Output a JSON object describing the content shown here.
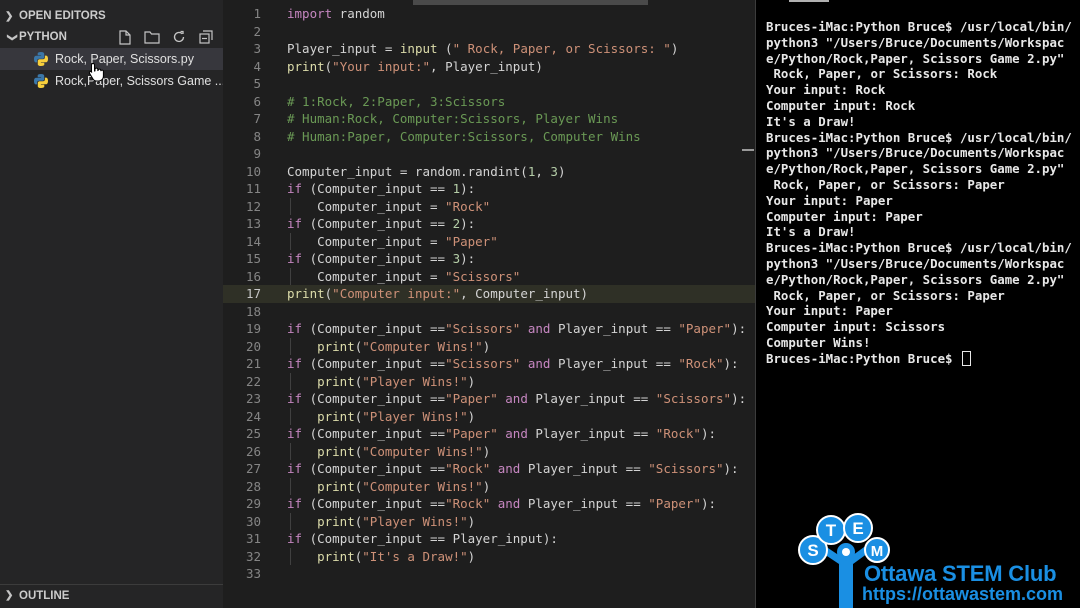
{
  "sidebar": {
    "open_editors_label": "OPEN EDITORS",
    "folder_label": "PYTHON",
    "outline_label": "OUTLINE",
    "actions": [
      "new-file-icon",
      "new-folder-icon",
      "refresh-icon",
      "collapse-all-icon"
    ],
    "files": [
      {
        "name": "Rock, Paper, Scissors.py",
        "selected": true
      },
      {
        "name": "Rock,Paper, Scissors Game ...",
        "selected": false
      }
    ]
  },
  "editor": {
    "current_line": 17,
    "lines": [
      {
        "n": "1",
        "tokens": [
          [
            "kw",
            "import"
          ],
          [
            "op",
            " random"
          ]
        ]
      },
      {
        "n": "2",
        "tokens": []
      },
      {
        "n": "3",
        "tokens": [
          [
            "op",
            "Player_input = "
          ],
          [
            "fn",
            "input"
          ],
          [
            "op",
            " ("
          ],
          [
            "str",
            "\" Rock, Paper, or Scissors: \""
          ],
          [
            "op",
            ")"
          ]
        ]
      },
      {
        "n": "4",
        "tokens": [
          [
            "fn",
            "print"
          ],
          [
            "op",
            "("
          ],
          [
            "str",
            "\"Your input:\""
          ],
          [
            "op",
            ", Player_input)"
          ]
        ]
      },
      {
        "n": "5",
        "tokens": []
      },
      {
        "n": "6",
        "tokens": [
          [
            "cm",
            "# 1:Rock, 2:Paper, 3:Scissors"
          ]
        ]
      },
      {
        "n": "7",
        "tokens": [
          [
            "cm",
            "# Human:Rock, Computer:Scissors, Player Wins"
          ]
        ]
      },
      {
        "n": "8",
        "tokens": [
          [
            "cm",
            "# Human:Paper, Computer:Scissors, Computer Wins"
          ]
        ]
      },
      {
        "n": "9",
        "tokens": []
      },
      {
        "n": "10",
        "tokens": [
          [
            "op",
            "Computer_input = random.randint("
          ],
          [
            "num",
            "1"
          ],
          [
            "op",
            ", "
          ],
          [
            "num",
            "3"
          ],
          [
            "op",
            ")"
          ]
        ]
      },
      {
        "n": "11",
        "tokens": [
          [
            "kw",
            "if"
          ],
          [
            "op",
            " (Computer_input == "
          ],
          [
            "num",
            "1"
          ],
          [
            "op",
            "):"
          ]
        ]
      },
      {
        "n": "12",
        "indent": true,
        "tokens": [
          [
            "op",
            "    Computer_input = "
          ],
          [
            "str",
            "\"Rock\""
          ]
        ]
      },
      {
        "n": "13",
        "tokens": [
          [
            "kw",
            "if"
          ],
          [
            "op",
            " (Computer_input == "
          ],
          [
            "num",
            "2"
          ],
          [
            "op",
            "):"
          ]
        ]
      },
      {
        "n": "14",
        "indent": true,
        "tokens": [
          [
            "op",
            "    Computer_input = "
          ],
          [
            "str",
            "\"Paper\""
          ]
        ]
      },
      {
        "n": "15",
        "tokens": [
          [
            "kw",
            "if"
          ],
          [
            "op",
            " (Computer_input == "
          ],
          [
            "num",
            "3"
          ],
          [
            "op",
            "):"
          ]
        ]
      },
      {
        "n": "16",
        "indent": true,
        "tokens": [
          [
            "op",
            "    Computer_input = "
          ],
          [
            "str",
            "\"Scissors\""
          ]
        ]
      },
      {
        "n": "17",
        "tokens": [
          [
            "fn",
            "print"
          ],
          [
            "op",
            "("
          ],
          [
            "str",
            "\"Computer input:\""
          ],
          [
            "op",
            ", Computer_input)"
          ]
        ]
      },
      {
        "n": "18",
        "tokens": []
      },
      {
        "n": "19",
        "tokens": [
          [
            "kw",
            "if"
          ],
          [
            "op",
            " (Computer_input =="
          ],
          [
            "str",
            "\"Scissors\""
          ],
          [
            "op",
            " "
          ],
          [
            "kw",
            "and"
          ],
          [
            "op",
            " Player_input == "
          ],
          [
            "str",
            "\"Paper\""
          ],
          [
            "op",
            "):"
          ]
        ]
      },
      {
        "n": "20",
        "indent": true,
        "tokens": [
          [
            "op",
            "    "
          ],
          [
            "fn",
            "print"
          ],
          [
            "op",
            "("
          ],
          [
            "str",
            "\"Computer Wins!\""
          ],
          [
            "op",
            ")"
          ]
        ]
      },
      {
        "n": "21",
        "tokens": [
          [
            "kw",
            "if"
          ],
          [
            "op",
            " (Computer_input =="
          ],
          [
            "str",
            "\"Scissors\""
          ],
          [
            "op",
            " "
          ],
          [
            "kw",
            "and"
          ],
          [
            "op",
            " Player_input == "
          ],
          [
            "str",
            "\"Rock\""
          ],
          [
            "op",
            "):"
          ]
        ]
      },
      {
        "n": "22",
        "indent": true,
        "tokens": [
          [
            "op",
            "    "
          ],
          [
            "fn",
            "print"
          ],
          [
            "op",
            "("
          ],
          [
            "str",
            "\"Player Wins!\""
          ],
          [
            "op",
            ")"
          ]
        ]
      },
      {
        "n": "23",
        "tokens": [
          [
            "kw",
            "if"
          ],
          [
            "op",
            " (Computer_input =="
          ],
          [
            "str",
            "\"Paper\""
          ],
          [
            "op",
            " "
          ],
          [
            "kw",
            "and"
          ],
          [
            "op",
            " Player_input == "
          ],
          [
            "str",
            "\"Scissors\""
          ],
          [
            "op",
            "):"
          ]
        ]
      },
      {
        "n": "24",
        "indent": true,
        "tokens": [
          [
            "op",
            "    "
          ],
          [
            "fn",
            "print"
          ],
          [
            "op",
            "("
          ],
          [
            "str",
            "\"Player Wins!\""
          ],
          [
            "op",
            ")"
          ]
        ]
      },
      {
        "n": "25",
        "tokens": [
          [
            "kw",
            "if"
          ],
          [
            "op",
            " (Computer_input =="
          ],
          [
            "str",
            "\"Paper\""
          ],
          [
            "op",
            " "
          ],
          [
            "kw",
            "and"
          ],
          [
            "op",
            " Player_input == "
          ],
          [
            "str",
            "\"Rock\""
          ],
          [
            "op",
            "):"
          ]
        ]
      },
      {
        "n": "26",
        "indent": true,
        "tokens": [
          [
            "op",
            "    "
          ],
          [
            "fn",
            "print"
          ],
          [
            "op",
            "("
          ],
          [
            "str",
            "\"Computer Wins!\""
          ],
          [
            "op",
            ")"
          ]
        ]
      },
      {
        "n": "27",
        "tokens": [
          [
            "kw",
            "if"
          ],
          [
            "op",
            " (Computer_input =="
          ],
          [
            "str",
            "\"Rock\""
          ],
          [
            "op",
            " "
          ],
          [
            "kw",
            "and"
          ],
          [
            "op",
            " Player_input == "
          ],
          [
            "str",
            "\"Scissors\""
          ],
          [
            "op",
            "):"
          ]
        ]
      },
      {
        "n": "28",
        "indent": true,
        "tokens": [
          [
            "op",
            "    "
          ],
          [
            "fn",
            "print"
          ],
          [
            "op",
            "("
          ],
          [
            "str",
            "\"Computer Wins!\""
          ],
          [
            "op",
            ")"
          ]
        ]
      },
      {
        "n": "29",
        "tokens": [
          [
            "kw",
            "if"
          ],
          [
            "op",
            " (Computer_input =="
          ],
          [
            "str",
            "\"Rock\""
          ],
          [
            "op",
            " "
          ],
          [
            "kw",
            "and"
          ],
          [
            "op",
            " Player_input == "
          ],
          [
            "str",
            "\"Paper\""
          ],
          [
            "op",
            "):"
          ]
        ]
      },
      {
        "n": "30",
        "indent": true,
        "tokens": [
          [
            "op",
            "    "
          ],
          [
            "fn",
            "print"
          ],
          [
            "op",
            "("
          ],
          [
            "str",
            "\"Player Wins!\""
          ],
          [
            "op",
            ")"
          ]
        ]
      },
      {
        "n": "31",
        "tokens": [
          [
            "kw",
            "if"
          ],
          [
            "op",
            " (Computer_input == Player_input):"
          ]
        ]
      },
      {
        "n": "32",
        "indent": true,
        "tokens": [
          [
            "op",
            "    "
          ],
          [
            "fn",
            "print"
          ],
          [
            "op",
            "("
          ],
          [
            "str",
            "\"It's a Draw!\""
          ],
          [
            "op",
            ")"
          ]
        ]
      },
      {
        "n": "33",
        "tokens": []
      }
    ]
  },
  "terminal": {
    "text": "Bruces-iMac:Python Bruce$ /usr/local/bin/python3 \"/Users/Bruce/Documents/Workspace/Python/Rock,Paper, Scissors Game 2.py\"\n Rock, Paper, or Scissors: Rock\nYour input: Rock\nComputer input: Rock\nIt's a Draw!\nBruces-iMac:Python Bruce$ /usr/local/bin/python3 \"/Users/Bruce/Documents/Workspace/Python/Rock,Paper, Scissors Game 2.py\"\n Rock, Paper, or Scissors: Paper\nYour input: Paper\nComputer input: Paper\nIt's a Draw!\nBruces-iMac:Python Bruce$ /usr/local/bin/python3 \"/Users/Bruce/Documents/Workspace/Python/Rock,Paper, Scissors Game 2.py\"\n Rock, Paper, or Scissors: Paper\nYour input: Paper\nComputer input: Scissors\nComputer Wins!\nBruces-iMac:Python Bruce$ "
  },
  "watermark": {
    "logo_letters": [
      "S",
      "T",
      "E",
      "M"
    ],
    "title": "Ottawa STEM Club",
    "url": "https://ottawastem.com"
  },
  "colors": {
    "keyword": "#c586c0",
    "function": "#dcdcaa",
    "string": "#ce9178",
    "number": "#b5cea8",
    "comment": "#6a9955",
    "brand_blue": "#1a8fe3"
  }
}
